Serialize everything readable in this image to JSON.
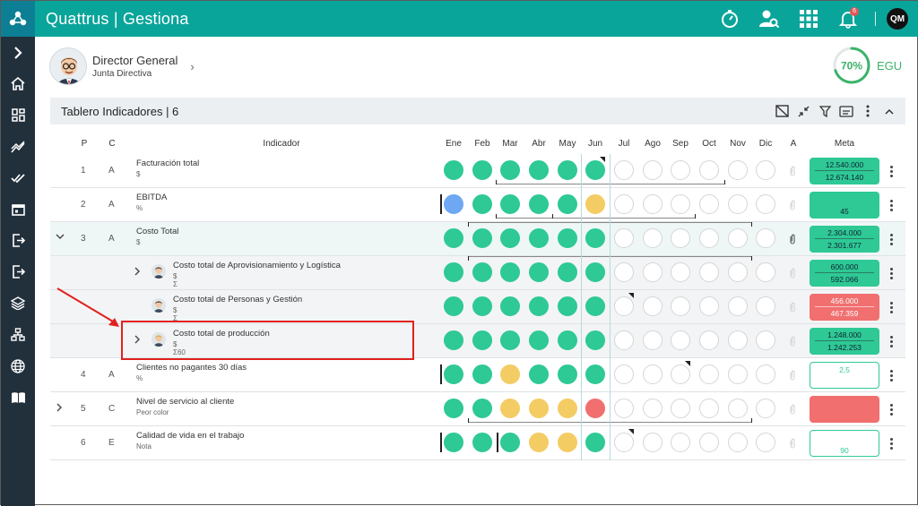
{
  "app": {
    "title": "Quattrus | Gestiona",
    "notif_count": "6",
    "user_initials": "QM"
  },
  "profile": {
    "name": "Director General",
    "role": "Junta Directiva",
    "egu_percent": "70%",
    "egu_value": 0.7,
    "egu_label": "EGU"
  },
  "panel": {
    "title": "Tablero Indicadores | 6"
  },
  "columns": {
    "p": "P",
    "c": "C",
    "indicador": "Indicador",
    "months": [
      "Ene",
      "Feb",
      "Mar",
      "Abr",
      "May",
      "Jun",
      "Jul",
      "Ago",
      "Sep",
      "Oct",
      "Nov",
      "Dic"
    ],
    "a": "A",
    "meta": "Meta"
  },
  "rows": [
    {
      "p": "1",
      "c": "A",
      "name": "Facturación total",
      "unit": "$",
      "unit2": "",
      "states": [
        "g",
        "g",
        "g",
        "g",
        "g",
        "g",
        "e",
        "e",
        "e",
        "e",
        "e",
        "e"
      ],
      "meta1": "12.540.000",
      "meta2": "12.674.140",
      "meta_style": "g"
    },
    {
      "p": "2",
      "c": "A",
      "name": "EBITDA",
      "unit": "%",
      "unit2": "",
      "states": [
        "b",
        "g",
        "g",
        "g",
        "g",
        "y",
        "e",
        "e",
        "e",
        "e",
        "e",
        "e"
      ],
      "meta1": "",
      "meta2": "45",
      "meta_style": "g"
    },
    {
      "p": "3",
      "c": "A",
      "name": "Costo Total",
      "unit": "$",
      "unit2": "",
      "states": [
        "g",
        "g",
        "g",
        "g",
        "g",
        "g",
        "e",
        "e",
        "e",
        "e",
        "e",
        "e"
      ],
      "meta1": "2.304.000",
      "meta2": "2.301.677",
      "meta_style": "g"
    },
    {
      "p": "",
      "c": "",
      "name": "Costo total de Aprovisionamiento y Logística",
      "unit": "$",
      "unit2": "Σ",
      "states": [
        "g",
        "g",
        "g",
        "g",
        "g",
        "g",
        "e",
        "e",
        "e",
        "e",
        "e",
        "e"
      ],
      "meta1": "600.000",
      "meta2": "592.066",
      "meta_style": "g"
    },
    {
      "p": "",
      "c": "",
      "name": "Costo total de Personas y Gestión",
      "unit": "$",
      "unit2": "Σ",
      "states": [
        "g",
        "g",
        "g",
        "g",
        "g",
        "g",
        "e",
        "e",
        "e",
        "e",
        "e",
        "e"
      ],
      "meta1": "456.000",
      "meta2": "467.359",
      "meta_style": "r"
    },
    {
      "p": "",
      "c": "",
      "name": "Costo total de producción",
      "unit": "$",
      "unit2": "Σ60",
      "states": [
        "g",
        "g",
        "g",
        "g",
        "g",
        "g",
        "e",
        "e",
        "e",
        "e",
        "e",
        "e"
      ],
      "meta1": "1.248.000",
      "meta2": "1.242.253",
      "meta_style": "g"
    },
    {
      "p": "4",
      "c": "A",
      "name": "Clientes no pagantes 30 días",
      "unit": "%",
      "unit2": "",
      "states": [
        "g",
        "g",
        "y",
        "g",
        "g",
        "g",
        "e",
        "e",
        "e",
        "e",
        "e",
        "e"
      ],
      "meta1": "2,5",
      "meta2": "",
      "meta_style": "o"
    },
    {
      "p": "5",
      "c": "C",
      "name": "Nivel de servicio al cliente",
      "unit": "Peor color",
      "unit2": "",
      "states": [
        "g",
        "g",
        "y",
        "y",
        "y",
        "r",
        "e",
        "e",
        "e",
        "e",
        "e",
        "e"
      ],
      "meta1": "",
      "meta2": "",
      "meta_style": "r"
    },
    {
      "p": "6",
      "c": "E",
      "name": "Calidad de vida en el trabajo",
      "unit": "Nota",
      "unit2": "",
      "states": [
        "g",
        "g",
        "g",
        "y",
        "y",
        "g",
        "e",
        "e",
        "e",
        "e",
        "e",
        "e"
      ],
      "meta1": "",
      "meta2": "90",
      "meta_style": "o"
    }
  ]
}
